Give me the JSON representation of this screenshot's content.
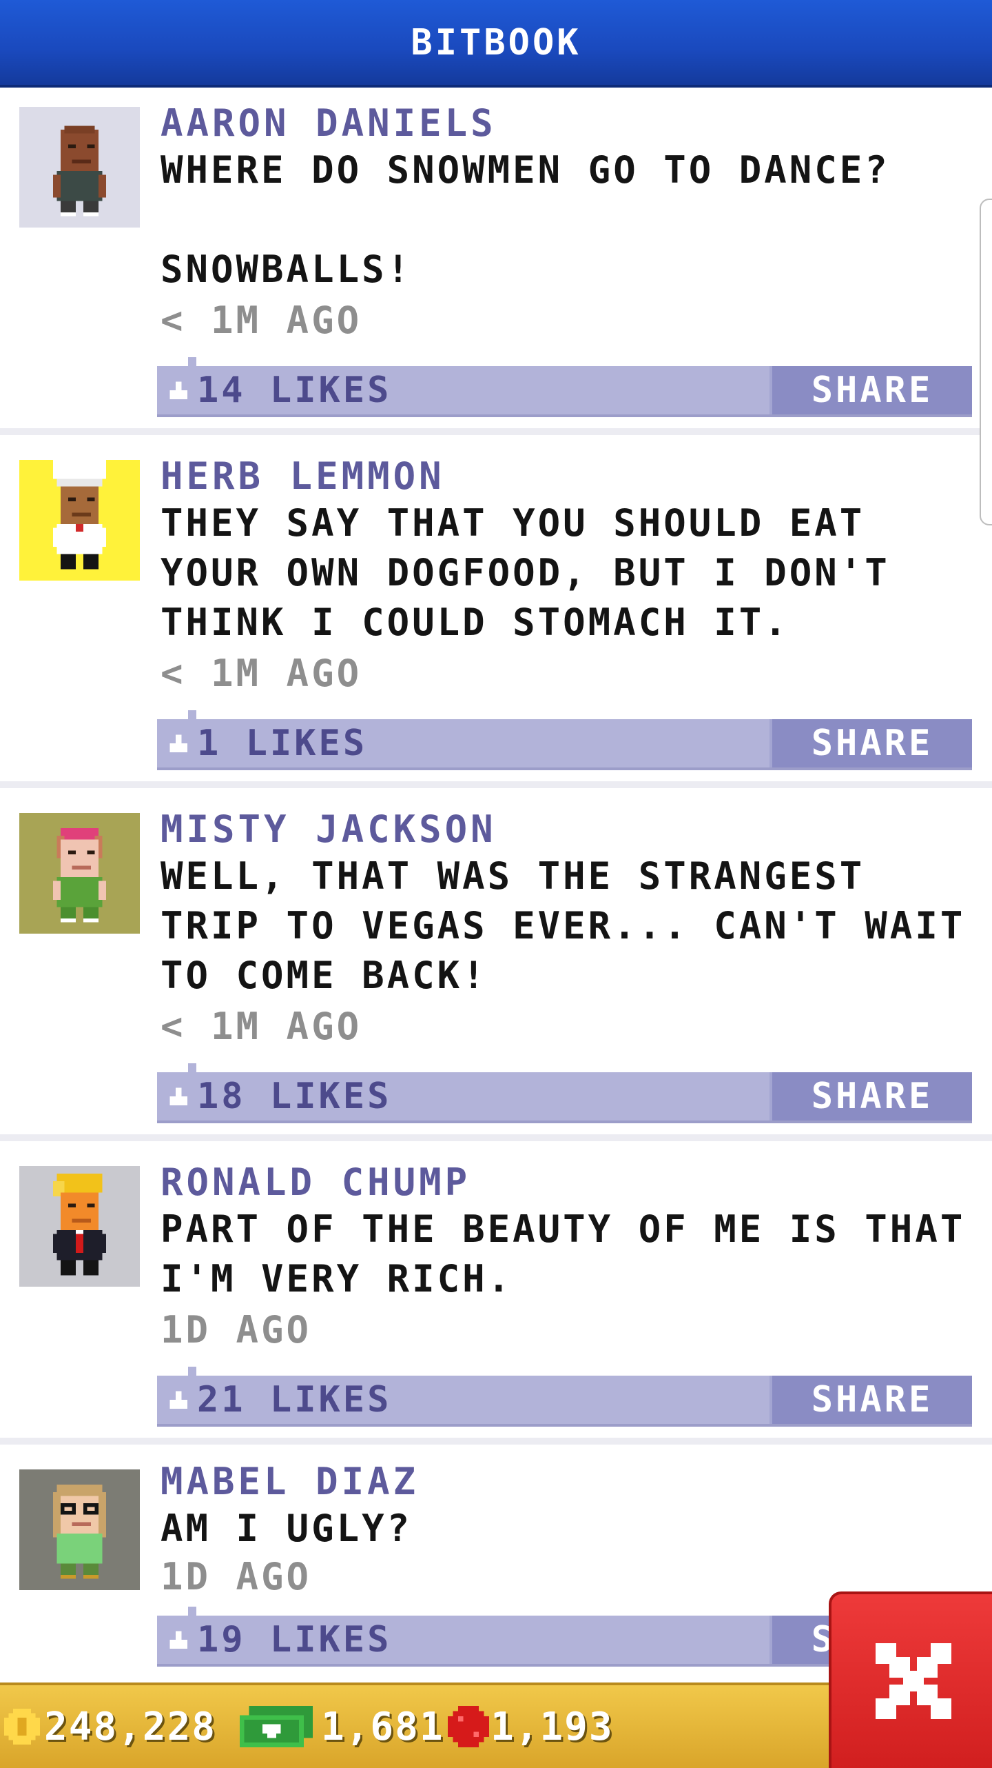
{
  "header": {
    "title": "BITBOOK"
  },
  "posts": [
    {
      "name": "AARON DANIELS",
      "message": "WHERE DO SNOWMEN GO TO DANCE?\n\nSNOWBALLS!",
      "time": "< 1M AGO",
      "likes": "14 LIKES",
      "share": "SHARE"
    },
    {
      "name": "HERB LEMMON",
      "message": "THEY SAY THAT YOU SHOULD EAT YOUR OWN DOGFOOD, BUT I DON'T THINK I COULD STOMACH IT.",
      "time": "< 1M AGO",
      "likes": "1 LIKES",
      "share": "SHARE"
    },
    {
      "name": "MISTY JACKSON",
      "message": "WELL, THAT WAS THE STRANGEST TRIP TO VEGAS EVER... CAN'T WAIT TO COME BACK!",
      "time": "< 1M AGO",
      "likes": "18 LIKES",
      "share": "SHARE"
    },
    {
      "name": "RONALD CHUMP",
      "message": "PART OF THE BEAUTY OF ME IS THAT I'M VERY RICH.",
      "time": "1D AGO",
      "likes": "21 LIKES",
      "share": "SHARE"
    },
    {
      "name": "MABEL DIAZ",
      "message": "AM I UGLY?",
      "time": "1D AGO",
      "likes": "19 LIKES",
      "share": "SHARE"
    }
  ],
  "footer": {
    "coins": "248,228",
    "cash": "1,681",
    "bux": "1,193"
  },
  "colors": {
    "header": "#1a49bd",
    "name": "#5d5a9c",
    "likes_bar": "#b2b3d9",
    "share_button": "#8a8cc4",
    "footer": "#e0b033",
    "close_button": "#e02a2a"
  }
}
